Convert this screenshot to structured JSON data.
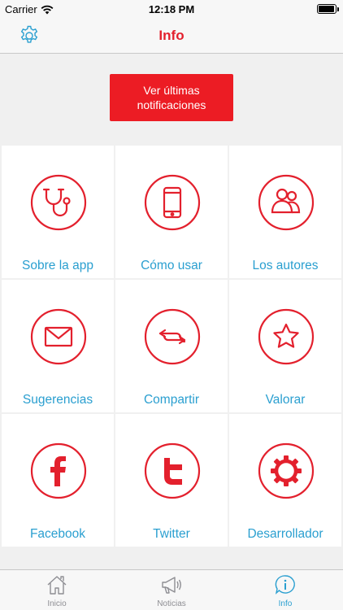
{
  "status_bar": {
    "carrier": "Carrier",
    "time": "12:18 PM"
  },
  "nav": {
    "title": "Info",
    "settings_icon": "gear-icon"
  },
  "notifications_button": {
    "label": "Ver últimas notificaciones"
  },
  "grid": {
    "items": [
      {
        "label": "Sobre la app",
        "icon": "stethoscope-icon"
      },
      {
        "label": "Cómo usar",
        "icon": "phone-icon"
      },
      {
        "label": "Los autores",
        "icon": "people-icon"
      },
      {
        "label": "Sugerencias",
        "icon": "envelope-icon"
      },
      {
        "label": "Compartir",
        "icon": "arrows-exchange-icon"
      },
      {
        "label": "Valorar",
        "icon": "star-icon"
      },
      {
        "label": "Facebook",
        "icon": "facebook-icon"
      },
      {
        "label": "Twitter",
        "icon": "twitter-icon"
      },
      {
        "label": "Desarrollador",
        "icon": "cog-icon"
      }
    ]
  },
  "tabs": [
    {
      "label": "Inicio",
      "icon": "home-icon",
      "active": false
    },
    {
      "label": "Noticias",
      "icon": "megaphone-icon",
      "active": false
    },
    {
      "label": "Info",
      "icon": "info-icon",
      "active": true
    }
  ],
  "colors": {
    "accent_red": "#ec1c24",
    "link_blue": "#2a9fd0",
    "background": "#f0f0f0"
  }
}
